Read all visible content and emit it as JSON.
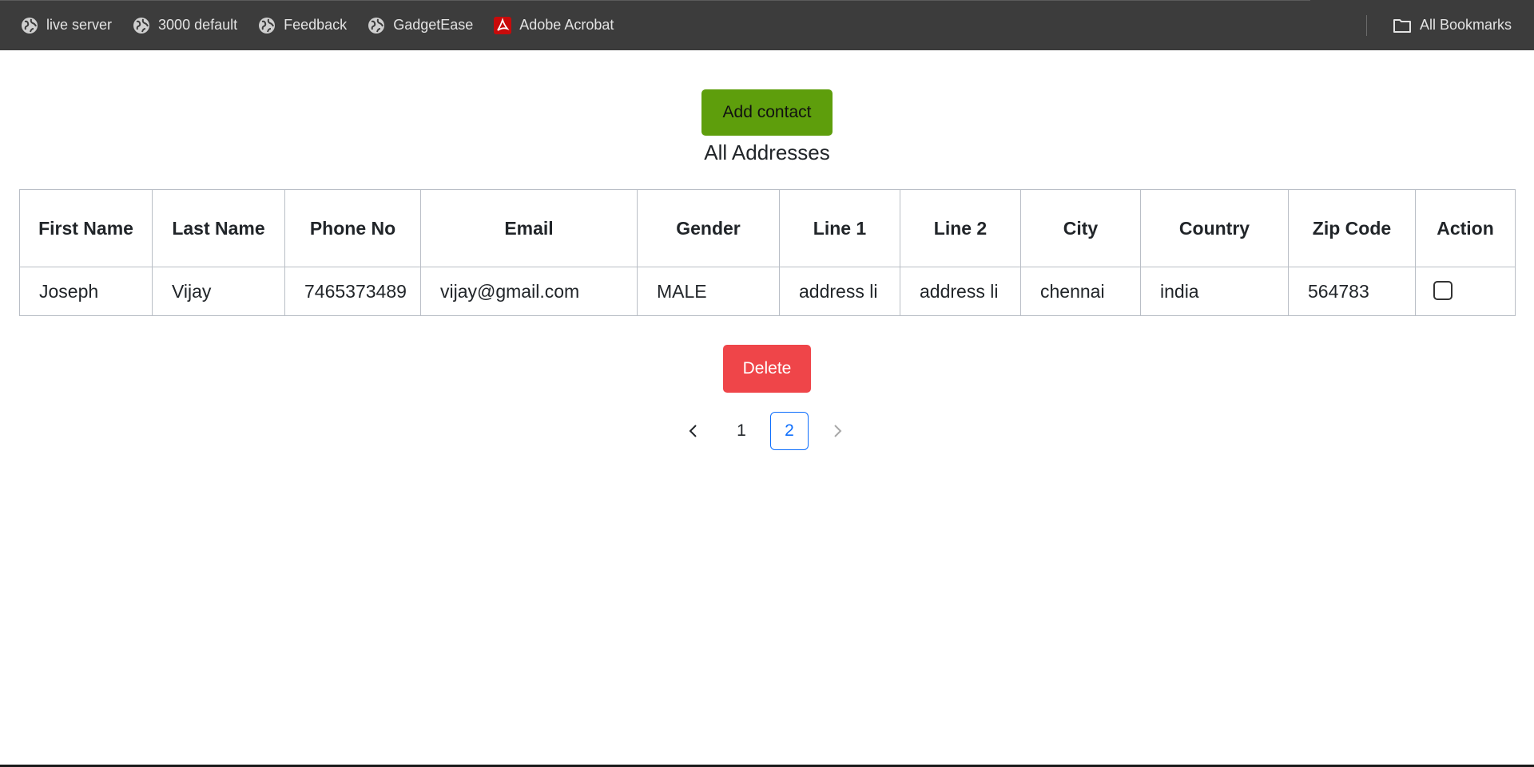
{
  "bookmarks": {
    "items": [
      {
        "label": "live server",
        "icon": "globe-icon"
      },
      {
        "label": "3000 default",
        "icon": "globe-icon"
      },
      {
        "label": "Feedback",
        "icon": "globe-icon"
      },
      {
        "label": "GadgetEase",
        "icon": "globe-icon"
      },
      {
        "label": "Adobe Acrobat",
        "icon": "acrobat-icon"
      }
    ],
    "all_bookmarks": "All Bookmarks"
  },
  "actions": {
    "add_label": "Add contact",
    "delete_label": "Delete"
  },
  "page": {
    "title": "All Addresses"
  },
  "table": {
    "headers": [
      "First Name",
      "Last Name",
      "Phone No",
      "Email",
      "Gender",
      "Line 1",
      "Line 2",
      "City",
      "Country",
      "Zip Code",
      "Action"
    ],
    "rows": [
      {
        "first_name": "Joseph",
        "last_name": "Vijay",
        "phone": "7465373489",
        "email": "vijay@gmail.com",
        "gender": "MALE",
        "line1": "address li",
        "line2": "address li",
        "city": "chennai",
        "country": "india",
        "zip": "564783",
        "selected": false
      }
    ]
  },
  "pagination": {
    "prev": "‹",
    "pages": [
      "1",
      "2"
    ],
    "current": "2",
    "next": "›"
  },
  "colors": {
    "add_button": "#5e9e0c",
    "delete_button": "#ef4549",
    "active_page": "#0d6efd",
    "bookmarks_bar": "#3c3c3c"
  }
}
